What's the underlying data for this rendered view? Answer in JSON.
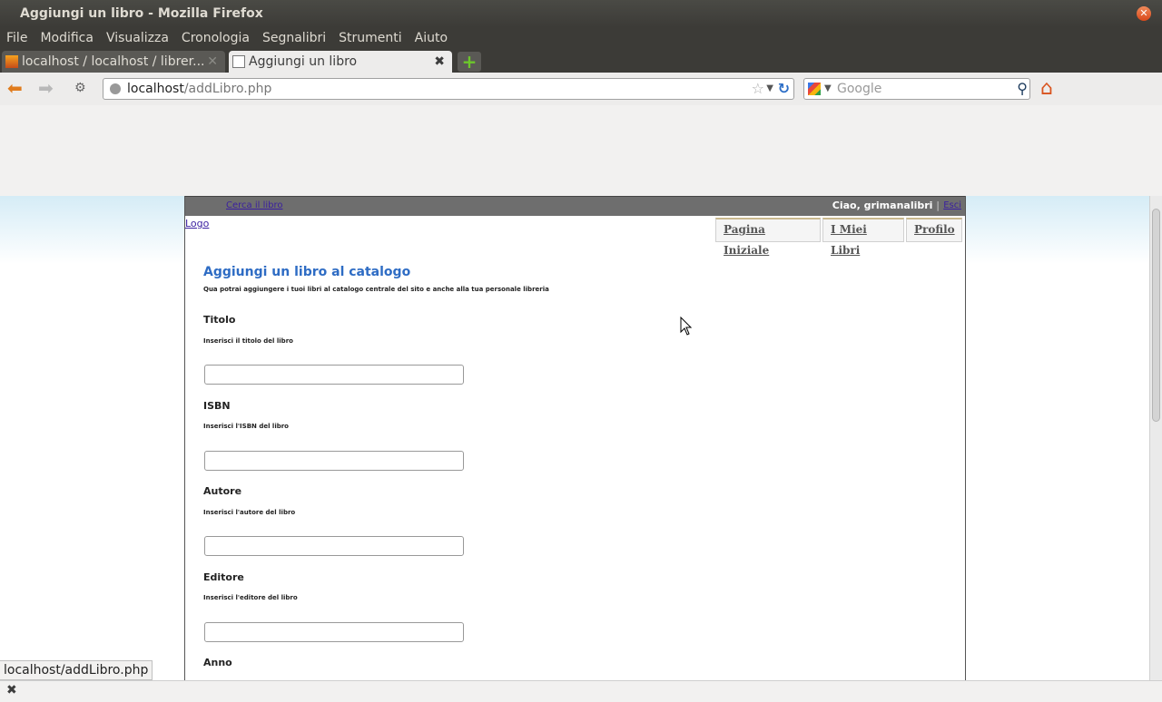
{
  "window": {
    "title": "Aggiungi un libro - Mozilla Firefox"
  },
  "menu": [
    "File",
    "Modifica",
    "Visualizza",
    "Cronologia",
    "Segnalibri",
    "Strumenti",
    "Aiuto"
  ],
  "tabs": [
    {
      "label": "localhost / localhost / librer..."
    },
    {
      "label": "Aggiungi un libro"
    }
  ],
  "nav": {
    "url_host": "localhost",
    "url_path": "/addLibro.php",
    "search_placeholder": "Google"
  },
  "site": {
    "search_link": "Cerca il libro",
    "greeting": "Ciao, grimanalibri",
    "separator": "|",
    "logout": "Esci",
    "logo": "Logo",
    "nav_tabs": [
      "Pagina Iniziale",
      "I Miei Libri",
      "Profilo"
    ],
    "title": "Aggiungi un libro al catalogo",
    "subtitle": "Qua potrai aggiungere i tuoi libri al catalogo centrale del sito e anche alla tua personale libreria",
    "fields": [
      {
        "label": "Titolo",
        "hint": "Inserisci il titolo del libro",
        "value": ""
      },
      {
        "label": "ISBN",
        "hint": "Inserisci l'ISBN del libro",
        "value": ""
      },
      {
        "label": "Autore",
        "hint": "Inserisci l'autore del libro",
        "value": ""
      },
      {
        "label": "Editore",
        "hint": "Inserisci l'editore del libro",
        "value": ""
      },
      {
        "label": "Anno"
      }
    ]
  },
  "status": {
    "url": "localhost/addLibro.php"
  }
}
